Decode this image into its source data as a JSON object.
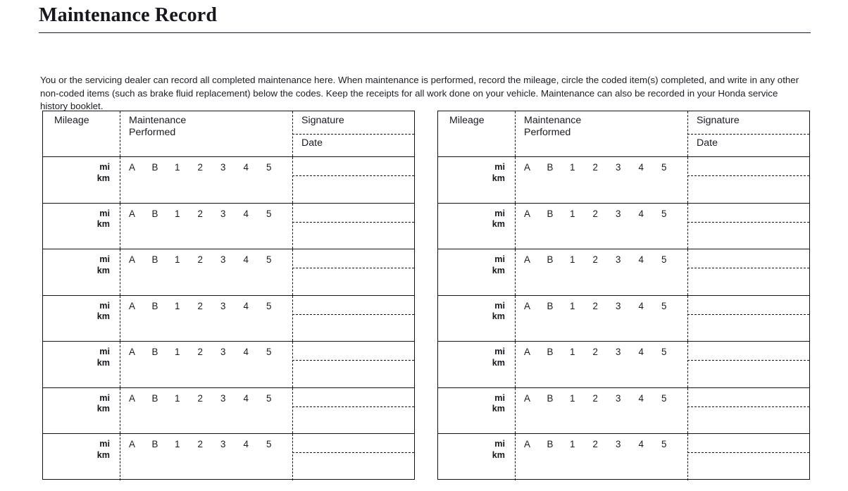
{
  "page": {
    "title": "Maintenance Record",
    "intro": "You or the servicing dealer can record all completed maintenance here. When maintenance is performed, record the mileage, circle the coded item(s) completed, and write in any other non-coded items (such as brake fluid replacement) below the codes. Keep the receipts for all work done on your vehicle. Maintenance can also be recorded in your Honda service history booklet."
  },
  "table": {
    "headers": {
      "mileage": "Mileage",
      "maintenance_line1": "Maintenance",
      "maintenance_line2": "Performed",
      "signature": "Signature",
      "date": "Date"
    },
    "row": {
      "unit_mi": "mi",
      "unit_km": "km",
      "codes": [
        "A",
        "B",
        "1",
        "2",
        "3",
        "4",
        "5"
      ]
    },
    "row_count": 7,
    "columns": [
      "Mileage",
      "Maintenance Performed",
      "Signature / Date"
    ]
  },
  "tables": [
    {
      "id": "table-left",
      "position": "left"
    },
    {
      "id": "table-right",
      "position": "right"
    }
  ],
  "colors": {
    "background": "#ffffff",
    "text": "#1c1c24",
    "rule": "#111118"
  }
}
